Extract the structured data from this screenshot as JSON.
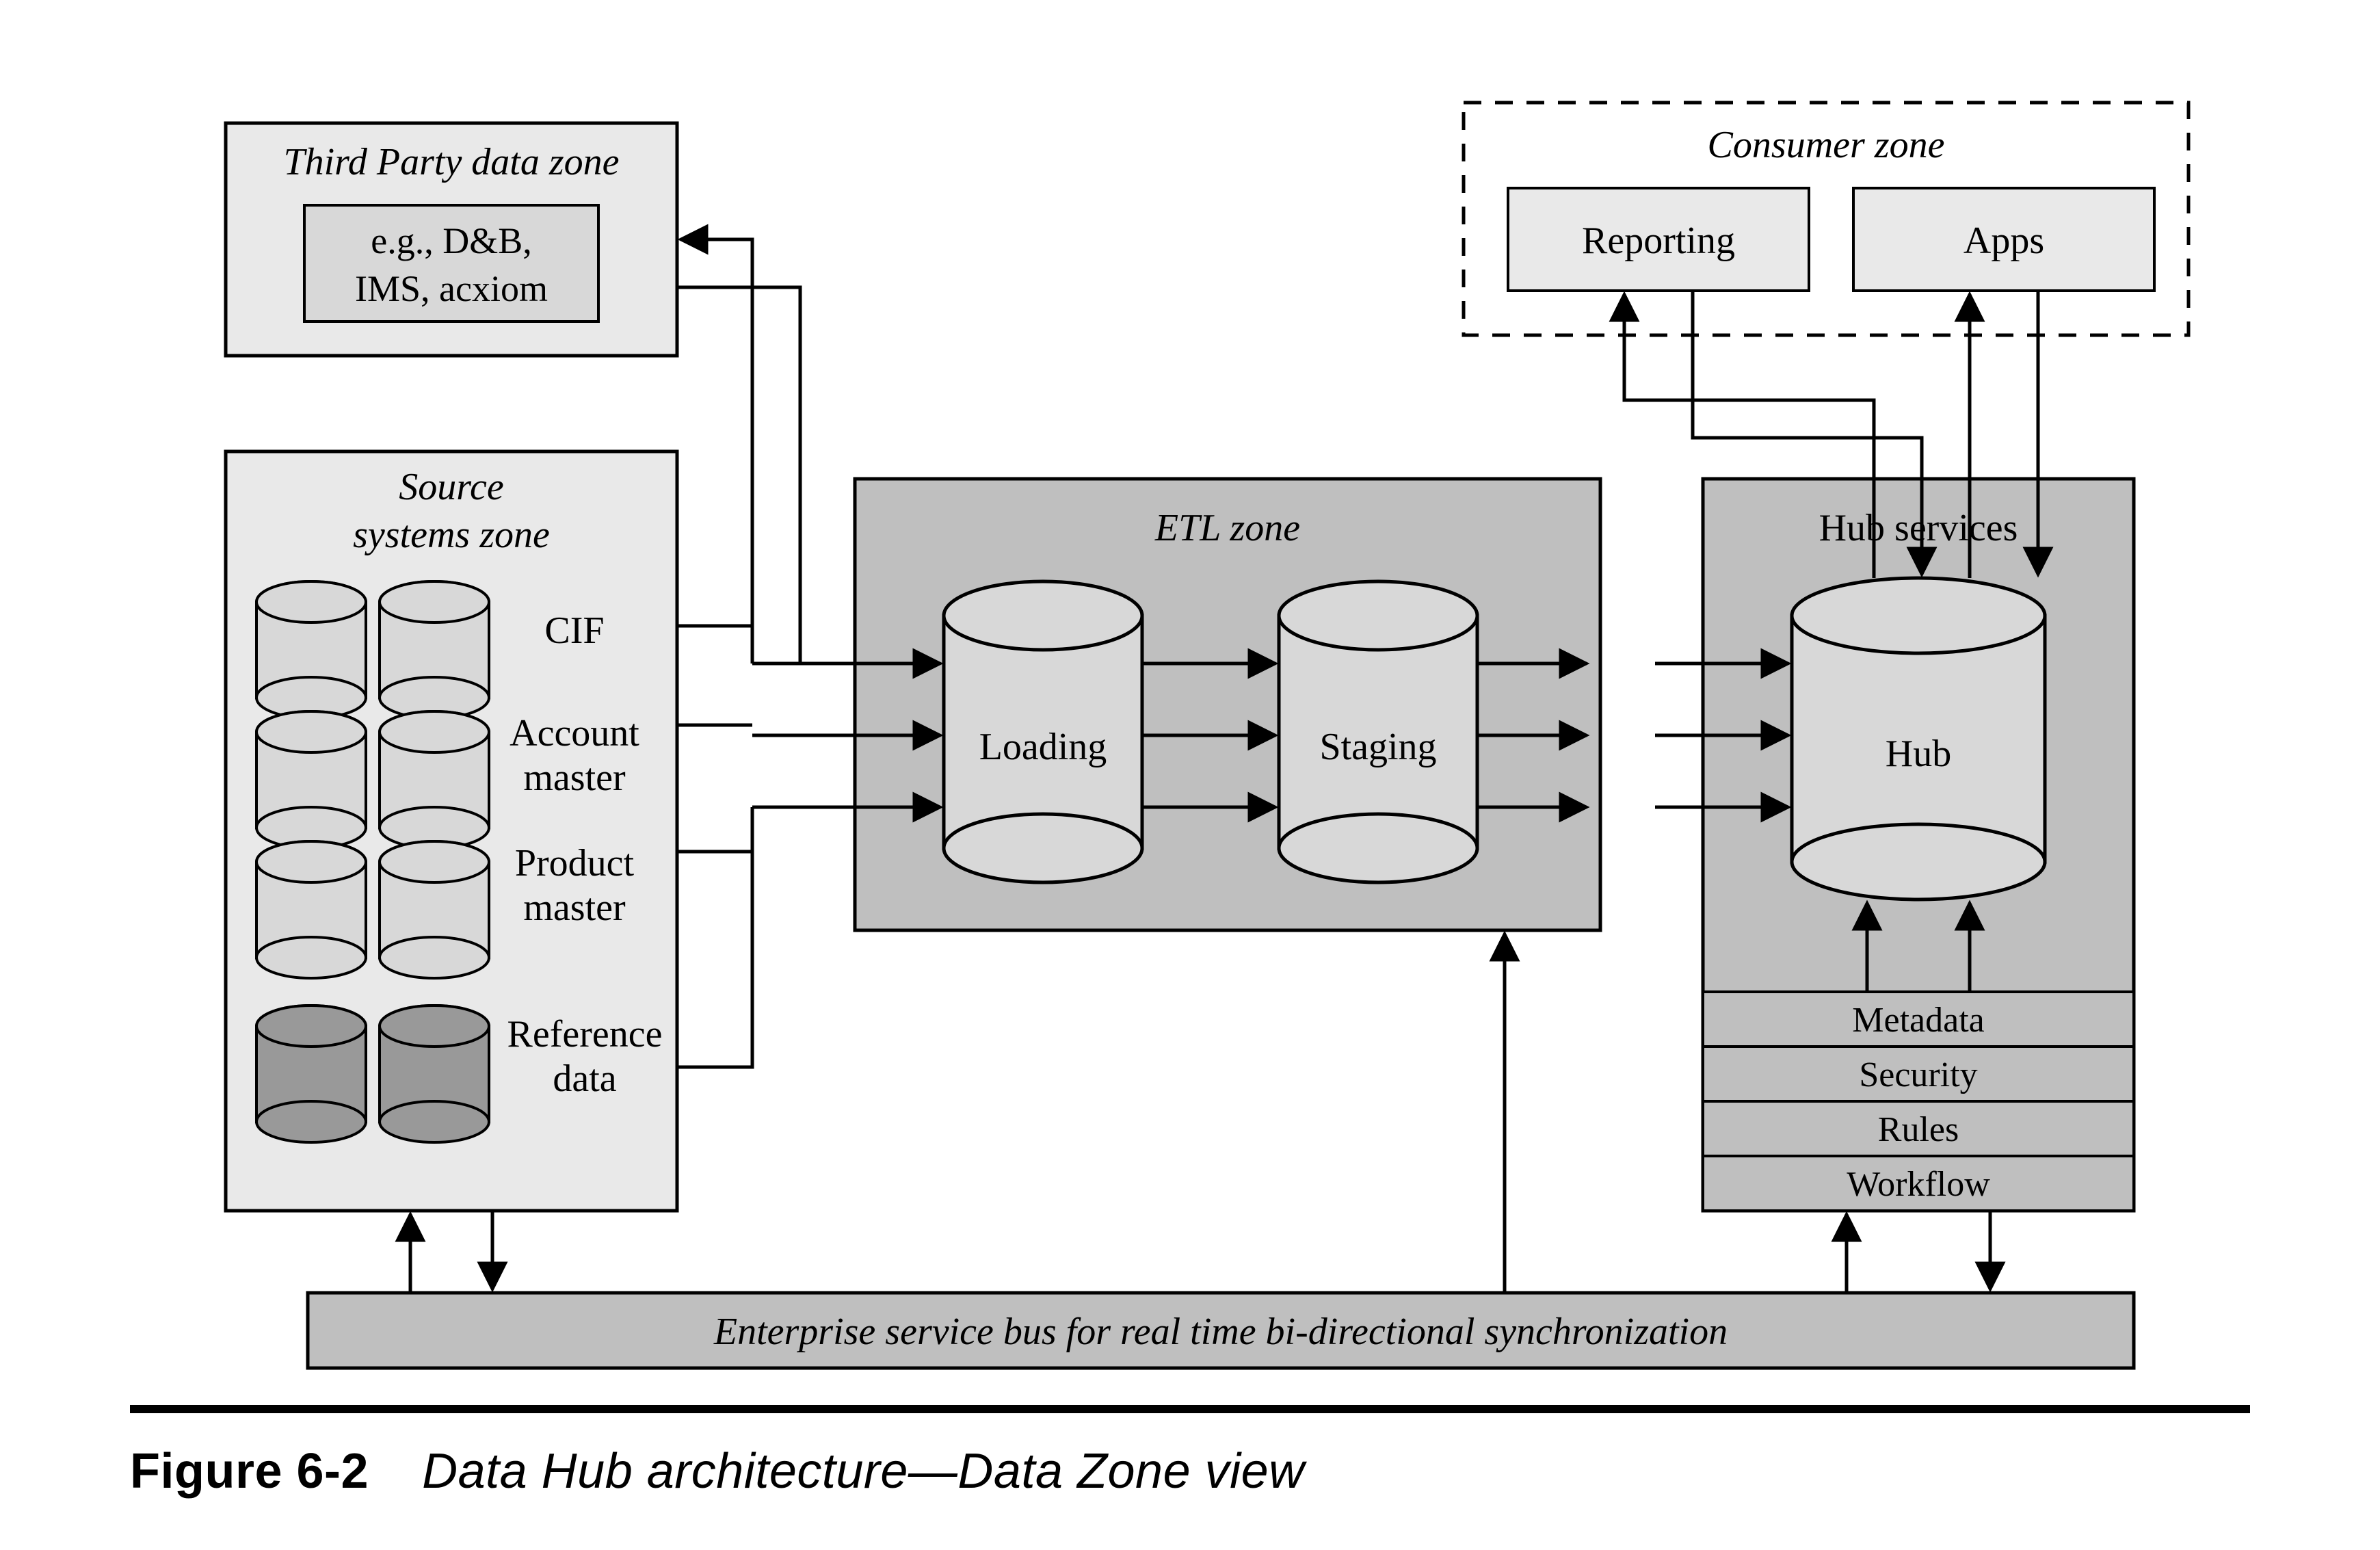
{
  "figure": {
    "number": "Figure 6-2",
    "title": "Data Hub architecture—Data Zone view"
  },
  "zones": {
    "third_party": {
      "title": "Third Party data zone",
      "example": "e.g., D&B, IMS, acxiom"
    },
    "source": {
      "title": "Source systems zone",
      "rows": [
        "CIF",
        "Account master",
        "Product master",
        "Reference data"
      ]
    },
    "etl": {
      "title": "ETL zone",
      "loading": "Loading",
      "staging": "Staging"
    },
    "consumer": {
      "title": "Consumer zone",
      "reporting": "Reporting",
      "apps": "Apps"
    },
    "hub": {
      "title": "Hub services",
      "db": "Hub",
      "layers": [
        "Metadata",
        "Security",
        "Rules",
        "Workflow"
      ]
    }
  },
  "bus": "Enterprise service bus for real time bi-directional synchronization"
}
